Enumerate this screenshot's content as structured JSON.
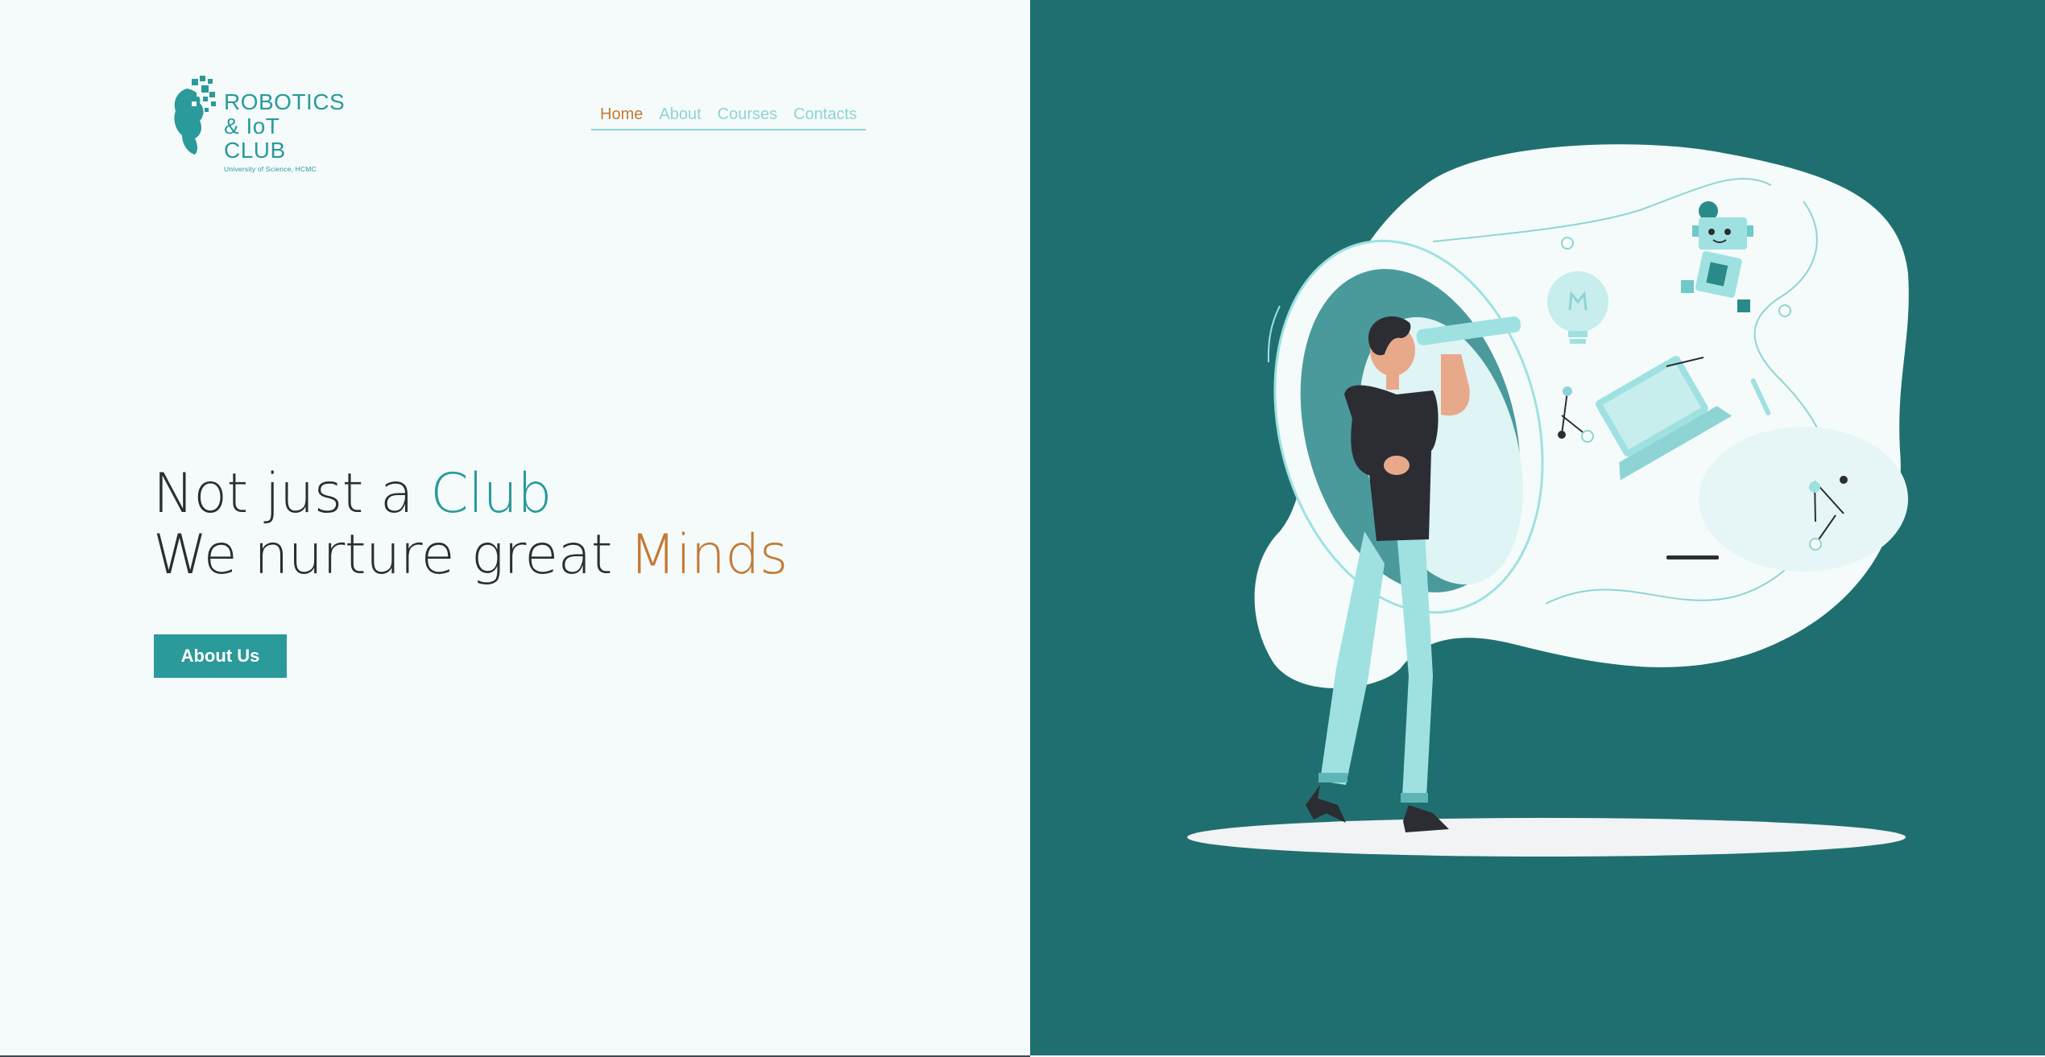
{
  "logo": {
    "line1": "ROBOTICS",
    "line2": "& IoT CLUB",
    "subtitle": "University of Science, HCMC"
  },
  "nav": {
    "items": [
      {
        "label": "Home",
        "active": true
      },
      {
        "label": "About",
        "active": false
      },
      {
        "label": "Courses",
        "active": false
      },
      {
        "label": "Contacts",
        "active": false
      }
    ]
  },
  "hero": {
    "line1_prefix": "Not just a ",
    "line1_accent": "Club",
    "line2_prefix": "We nurture great ",
    "line2_accent": "Minds",
    "button_label": "About Us"
  },
  "colors": {
    "brand_teal": "#2a9a9a",
    "accent_orange": "#c47a35",
    "panel_teal": "#206f70",
    "background": "#f5fbfb",
    "nav_inactive": "#8fd4d4"
  },
  "icons": {
    "logo_mark": "brain-circuit-icon",
    "illustration": "person-with-telescope-illustration"
  }
}
